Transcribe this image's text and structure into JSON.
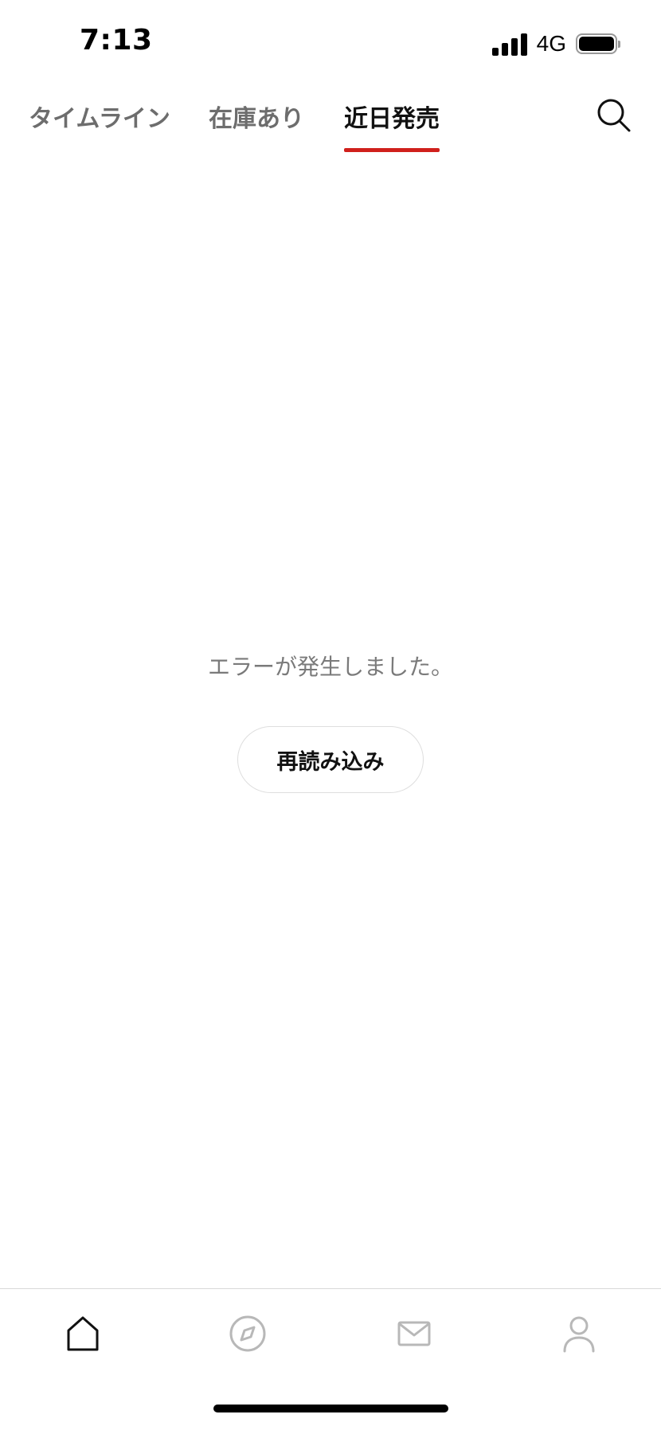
{
  "status_bar": {
    "time": "7:13",
    "network": "4G",
    "icons": [
      "signal-bars-icon",
      "battery-icon"
    ]
  },
  "top_nav": {
    "tabs": [
      {
        "label": "タイムライン",
        "active": false
      },
      {
        "label": "在庫あり",
        "active": false
      },
      {
        "label": "近日発売",
        "active": true
      }
    ],
    "search_icon": "search-icon",
    "accent_color": "#d0201c"
  },
  "main": {
    "error_message": "エラーが発生しました。",
    "reload_label": "再読み込み"
  },
  "bottom_nav": {
    "items": [
      {
        "icon": "home-icon",
        "active": true
      },
      {
        "icon": "compass-icon",
        "active": false
      },
      {
        "icon": "mail-icon",
        "active": false
      },
      {
        "icon": "profile-icon",
        "active": false
      }
    ]
  }
}
